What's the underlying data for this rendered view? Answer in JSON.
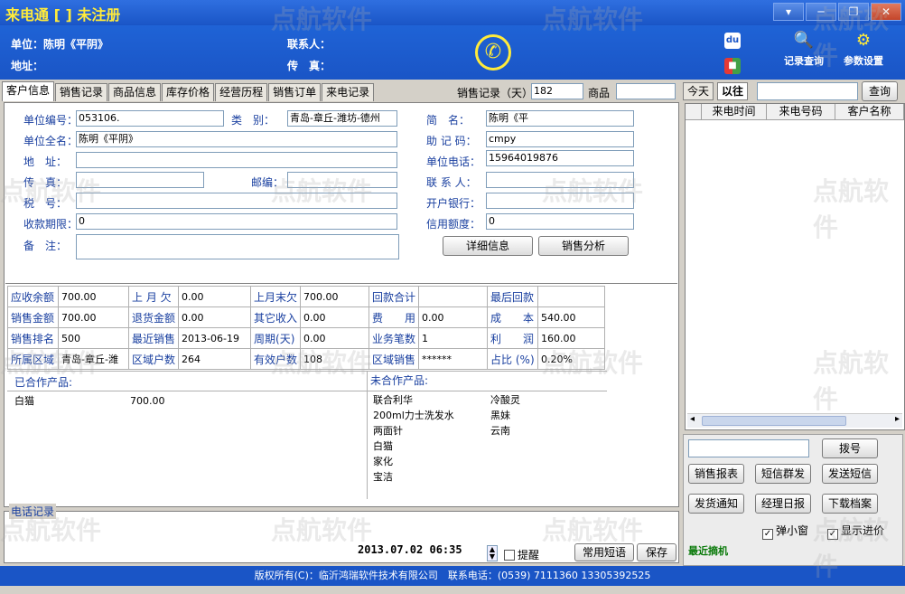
{
  "window": {
    "title": "来电通 [ ] 未注册",
    "buttons": [
      "▾",
      "─",
      "❐",
      "✕"
    ]
  },
  "header": {
    "unit_label": "单位：陈明《平阴》",
    "address_label": "地址：",
    "contact_label": "联系人：",
    "fax_label": "传　真：",
    "search_records": "记录查询",
    "settings": "参数设置"
  },
  "tabs": [
    "客户信息",
    "销售记录",
    "商品信息",
    "库存价格",
    "经营历程",
    "销售订单",
    "来电记录"
  ],
  "topbar": {
    "sales_days_label": "销售记录（天）",
    "sales_days_value": "182",
    "product_label": "商品",
    "product_value": ""
  },
  "form": {
    "unit_code_label": "单位编号：",
    "unit_code": "053106.",
    "category_label": "类　别：",
    "category": "青岛-章丘-潍坊-德州",
    "short_name_label": "简　名：",
    "short_name": "陈明《平",
    "full_name_label": "单位全名：",
    "full_name": "陈明《平阴》",
    "mnemonic_label": "助 记 码：",
    "mnemonic": "cmpy",
    "address_label": "地　址：",
    "address": "",
    "unit_phone_label": "单位电话：",
    "unit_phone": "15964019876",
    "fax_label": "传　真：",
    "fax": "",
    "postcode_label": "邮编：",
    "postcode": "",
    "contact_label": "联 系 人：",
    "contact": "",
    "tax_label": "税　号：",
    "tax": "",
    "bank_label": "开户银行：",
    "bank": "",
    "payment_term_label": "收款期限：",
    "payment_term": "0",
    "credit_label": "信用额度：",
    "credit": "0",
    "remark_label": "备　注：",
    "remark": "",
    "detail_button": "详细信息",
    "analysis_button": "销售分析"
  },
  "stats": [
    [
      "应收余额",
      "700.00",
      "上 月 欠",
      "0.00",
      "上月末欠",
      "700.00",
      "回款合计",
      "",
      "最后回款",
      ""
    ],
    [
      "销售金额",
      "700.00",
      "退货金额",
      "0.00",
      "其它收入",
      "0.00",
      "费　　用",
      "0.00",
      "成　　本",
      "540.00"
    ],
    [
      "销售排名",
      "500",
      "最近销售",
      "2013-06-19",
      "周期(天)",
      "0.00",
      "业务笔数",
      "1",
      "利　　润",
      "160.00"
    ],
    [
      "所属区域",
      "青岛-章丘-潍",
      "区域户数",
      "264",
      "有效户数",
      "108",
      "区域销售",
      "******",
      "占比 (%)",
      "0.20%"
    ]
  ],
  "cooperated": {
    "label": "已合作产品:",
    "items": [
      {
        "name": "白猫",
        "amount": "700.00"
      }
    ]
  },
  "not_cooperated": {
    "label": "未合作产品:",
    "col1": [
      "联合利华",
      "200ml力士洗发水",
      "两面针",
      "白猫",
      "家化",
      "宝洁"
    ],
    "col2": [
      "冷酸灵",
      "黑妹",
      "云南"
    ]
  },
  "phone_record": {
    "label": "电话记录",
    "datetime": "2013.07.02  06:35",
    "remind_label": "提醒",
    "common_phrases": "常用短语",
    "save": "保存"
  },
  "footer": {
    "text": "版权所有(C)：临沂鸿瑞软件技术有限公司　联系电话：(0539) 7111360 13305392525"
  },
  "right": {
    "tab_today": "今天",
    "tab_past": "以往",
    "search_value": "",
    "query": "查询",
    "columns": [
      "来电时间",
      "来电号码",
      "客户名称"
    ],
    "dial": "拨号",
    "sales_report": "销售报表",
    "sms_group": "短信群发",
    "send_sms": "发送短信",
    "ship_notice": "发货通知",
    "manager_daily": "经理日报",
    "download": "下载档案",
    "popup_label": "弹小窗",
    "show_progress_label": "显示进价",
    "recent_hangup": "最近摘机"
  },
  "watermark": "点航软件",
  "colors": {
    "title_bar": "#1a55c6",
    "title_text": "#ffeb3b",
    "label_blue": "#1a40a0"
  }
}
